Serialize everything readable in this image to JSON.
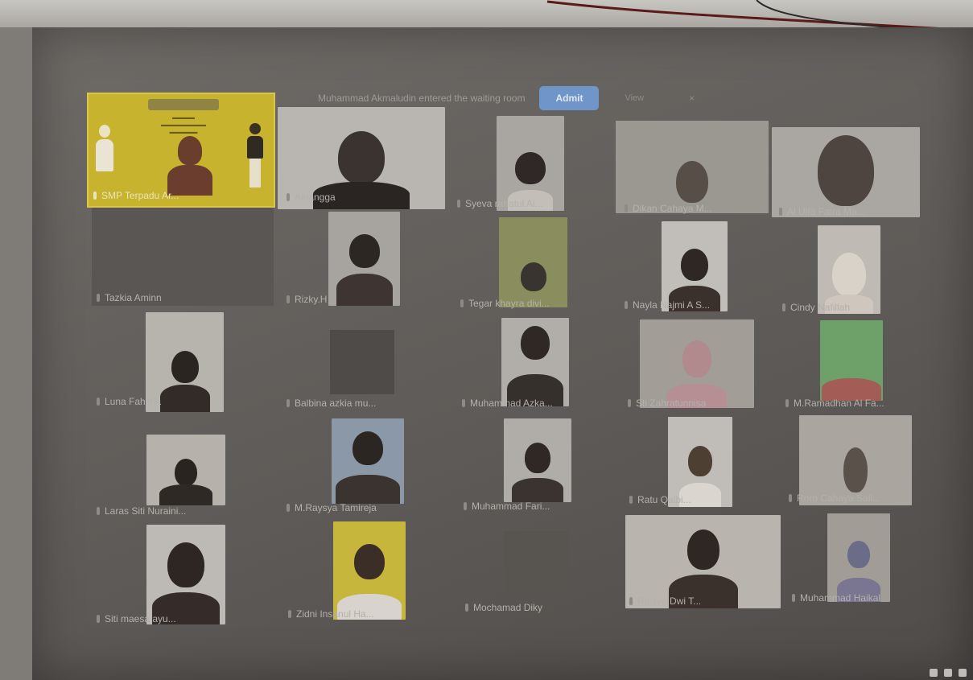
{
  "notification": {
    "message": "Muhammad Akmaludin entered the waiting room",
    "admit_label": "Admit",
    "view_label": "View",
    "close_label": "×"
  },
  "colors": {
    "admit_button": "#6f95c9",
    "featured_border": "#d9c64a",
    "screen_bg": "#5f5b58"
  },
  "participants": [
    {
      "name": "SMP Terpadu Ar..."
    },
    {
      "name": "Airlangga"
    },
    {
      "name": "Syeva rahatul Ai..."
    },
    {
      "name": "Dikan Cahaya M..."
    },
    {
      "name": "Al Ulfa Fatra Ma..."
    },
    {
      "name": "Tazkia Aminn"
    },
    {
      "name": "Rizky.H"
    },
    {
      "name": "Tegar khayra divi..."
    },
    {
      "name": "Nayla Najmi A S..."
    },
    {
      "name": "Cindy Nafillah"
    },
    {
      "name": "Luna Fahima"
    },
    {
      "name": "Balbina azkia mu..."
    },
    {
      "name": "Muhammad Azka..."
    },
    {
      "name": "Sti Zahratunnisa"
    },
    {
      "name": "M.Ramadhan Al Fa..."
    },
    {
      "name": "Laras Siti Nuraini..."
    },
    {
      "name": "M.Raysya Tamireja"
    },
    {
      "name": "Muhammad Fari..."
    },
    {
      "name": "Ratu Qalbi..."
    },
    {
      "name": "Roro Cahaya Sali..."
    },
    {
      "name": "Siti maesa ayu..."
    },
    {
      "name": "Zidni Insanul Ha..."
    },
    {
      "name": "Mochamad Diky"
    },
    {
      "name": "Raisya Dwi T..."
    },
    {
      "name": "Muhammad Haikal"
    }
  ]
}
